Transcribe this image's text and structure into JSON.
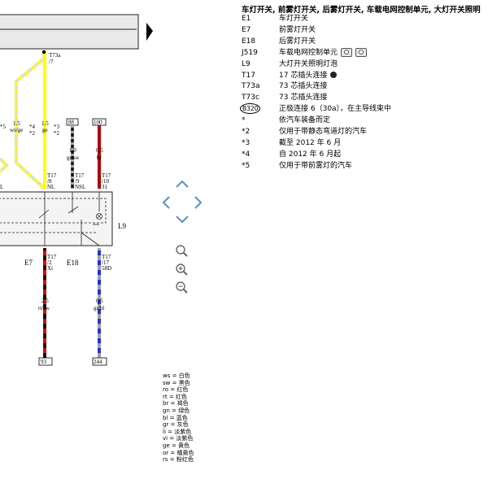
{
  "legend": {
    "title": "车灯开关, 前雾灯开关, 后雾灯开关, 车载电网控制单元, 大灯开关照明",
    "items": [
      {
        "code": "E1",
        "desc": "车灯开关"
      },
      {
        "code": "E7",
        "desc": "前雾灯开关"
      },
      {
        "code": "E18",
        "desc": "后雾灯开关"
      },
      {
        "code": "J519",
        "desc": "车载电网控制单元",
        "icon": "camera-icon-pair"
      },
      {
        "code": "L9",
        "desc": "大灯开关照明灯泡"
      },
      {
        "code": "T17",
        "desc": "17 芯插头连接",
        "icon": "connector-pin-icon"
      },
      {
        "code": "T73a",
        "desc": "73 芯插头连接"
      },
      {
        "code": "T73c",
        "desc": "73 芯插头连接"
      },
      {
        "code": "B320",
        "desc": "正极连接 6（30a），在主导线束中",
        "circled": true
      },
      {
        "code": "*",
        "desc": "依汽车装备而定"
      },
      {
        "code": "*2",
        "desc": "仅用于带静态弯道灯的汽车"
      },
      {
        "code": "*3",
        "desc": "截至 2012 年 6 月"
      },
      {
        "code": "*4",
        "desc": "自 2012 年 6 月起"
      },
      {
        "code": "*5",
        "desc": "仅用于带前雾灯的汽车"
      }
    ]
  },
  "color_legend": [
    "ws = 白色",
    "sw = 黑色",
    "ro = 红色",
    "rt = 红色",
    "br = 褐色",
    "gn = 绿色",
    "bl = 蓝色",
    "gr = 灰色",
    "li = 淡紫色",
    "vi = 淡紫色",
    "ge = 黄色",
    "or = 橘黄色",
    "rs = 粉红色"
  ],
  "diagram": {
    "t73a": "T73a",
    "t73a_pin": "/7",
    "note5": "*5",
    "note4": "*4",
    "note2a": "*2",
    "note3": "*3",
    "note2b": "*2",
    "w1_size": "1.5",
    "w1_color": "ws/ge",
    "w2_size": "1.5",
    "w2_color": "ge",
    "w3_size": "1.0",
    "w3_color": "gr/sw",
    "w4_size": "0.5",
    "w4_color": "br",
    "conn88": "88",
    "conn100": "100",
    "p8_a": "T17",
    "p8_b": "/8",
    "p8_c": "NL",
    "p9_a": "T17",
    "p9_b": "/9",
    "p9_c": "NSL",
    "p10_a": "T17",
    "p10_b": "/10",
    "p10_c": "31",
    "left_label": "L",
    "l9": "L9",
    "e7": "E7",
    "e18": "E18",
    "p2_a": "T17",
    "p2_b": "/2",
    "p2_c": "Xi",
    "p17_a": "T17",
    "p17_b": "/17",
    "p17_c": "58D",
    "w5_size": "2.5",
    "w5_color": "rt/sw",
    "w6_size": "0.5",
    "w6_color": "gr/bl",
    "conn93": "93",
    "conn244": "244"
  }
}
